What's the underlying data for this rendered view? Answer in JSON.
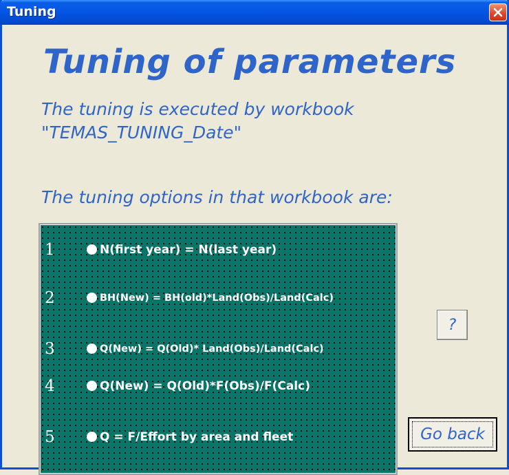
{
  "window": {
    "title": "Tuning"
  },
  "heading": "Tuning of parameters",
  "description": {
    "line1": "The tuning is executed by workbook",
    "line2": "\"TEMAS_TUNING_Date\""
  },
  "options_title": "The tuning options in that workbook are:",
  "options": [
    {
      "number": "1",
      "label": "N(first year) = N(last year)"
    },
    {
      "number": "2",
      "label": "BH(New) = BH(old)*Land(Obs)/Land(Calc)"
    },
    {
      "number": "3",
      "label": "Q(New) = Q(Old)* Land(Obs)/Land(Calc)"
    },
    {
      "number": "4",
      "label": "Q(New) = Q(Old)*F(Obs)/F(Calc)"
    },
    {
      "number": "5",
      "label": "Q = F/Effort by area and fleet"
    }
  ],
  "buttons": {
    "help": "?",
    "back": "Go back"
  },
  "icons": {
    "close": "close-icon"
  },
  "colors": {
    "title_bar": "#0554e3",
    "accent_text": "#2f64c9",
    "options_background": "#0b7468",
    "dialog_background": "#ece9d8",
    "close_button": "#d9462a"
  }
}
